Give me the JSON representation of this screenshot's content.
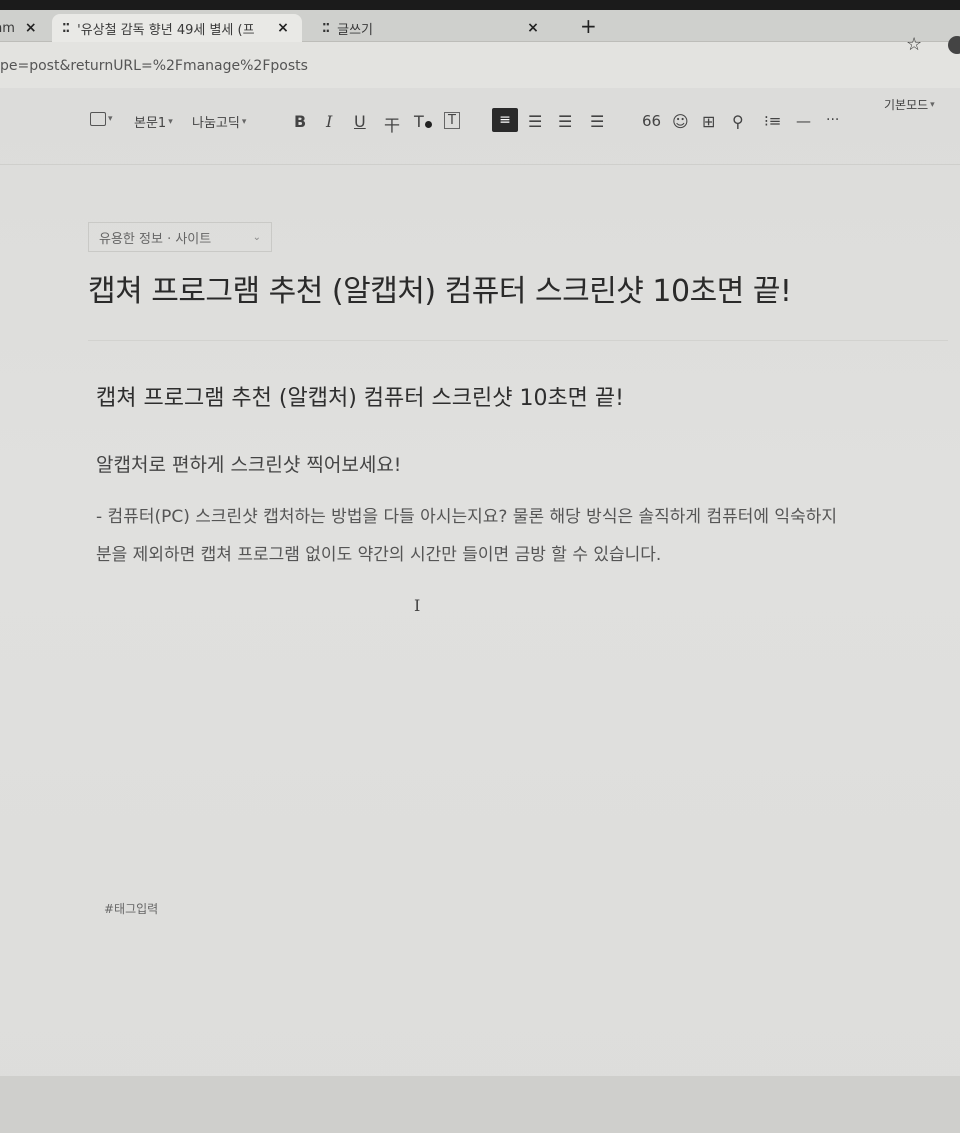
{
  "browser": {
    "tabs": [
      {
        "label": "nm"
      },
      {
        "label": "'유상철 감독 향년 49세 별세 (프"
      },
      {
        "label": "글쓰기"
      }
    ],
    "new_tab": "+",
    "close": "×",
    "url": "pe=post&returnURL=%2Fmanage%2Fposts"
  },
  "toolbar": {
    "paragraph_style": "본문1",
    "font": "나눔고딕",
    "bold": "B",
    "italic": "I",
    "underline": "U",
    "strike": "干",
    "text_color": "T",
    "text_bg": "T",
    "quote": "66",
    "more": "···",
    "mode": "기본모드"
  },
  "editor": {
    "category": "유용한 정보 · 사이트",
    "title": "캡쳐 프로그램 추천 (알캡처) 컴퓨터 스크린샷 10초면 끝!",
    "heading": "캡쳐 프로그램 추천 (알캡처) 컴퓨터 스크린샷 10초면 끝!",
    "lead": "알캡처로 편하게 스크린샷 찍어보세요!",
    "body_line1": "- 컴퓨터(PC) 스크린샷 캡처하는 방법을 다들 아시는지요? 물론 해당 방식은 솔직하게 컴퓨터에 익숙하지",
    "body_line2": "분을 제외하면 캡쳐 프로그램 없이도 약간의 시간만 들이면 금방 할 수 있습니다.",
    "tag_placeholder": "#태그입력"
  }
}
